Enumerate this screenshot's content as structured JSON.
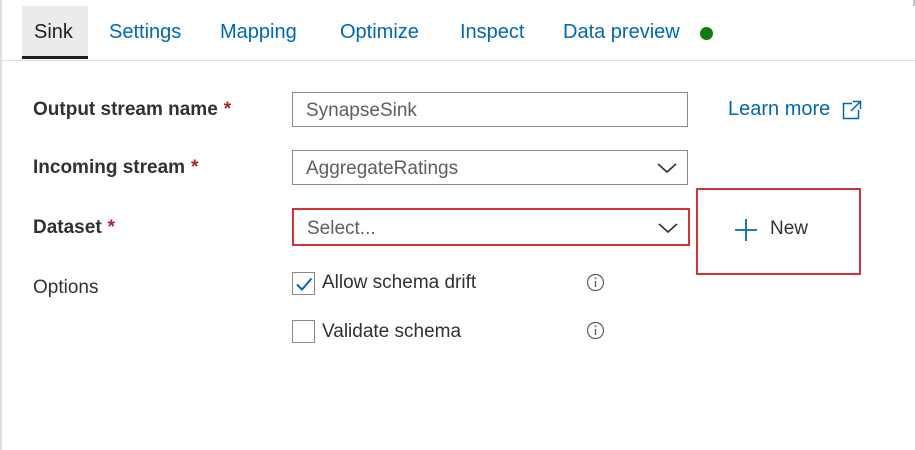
{
  "tabs": [
    {
      "label": "Sink"
    },
    {
      "label": "Settings"
    },
    {
      "label": "Mapping"
    },
    {
      "label": "Optimize"
    },
    {
      "label": "Inspect"
    },
    {
      "label": "Data preview"
    }
  ],
  "colors": {
    "link": "#0067b8",
    "required": "#a4262c",
    "error_border": "#d13438",
    "status_ok": "#107c10"
  },
  "form": {
    "output_stream": {
      "label": "Output stream name",
      "required": "*",
      "value": "SynapseSink"
    },
    "incoming_stream": {
      "label": "Incoming stream",
      "required": "*",
      "value": "AggregateRatings"
    },
    "dataset": {
      "label": "Dataset",
      "required": "*",
      "placeholder": "Select..."
    },
    "options": {
      "label": "Options",
      "allow_schema_drift": {
        "label": "Allow schema drift",
        "checked": true
      },
      "validate_schema": {
        "label": "Validate schema",
        "checked": false
      }
    }
  },
  "learn_more": "Learn more",
  "new_button": "New"
}
